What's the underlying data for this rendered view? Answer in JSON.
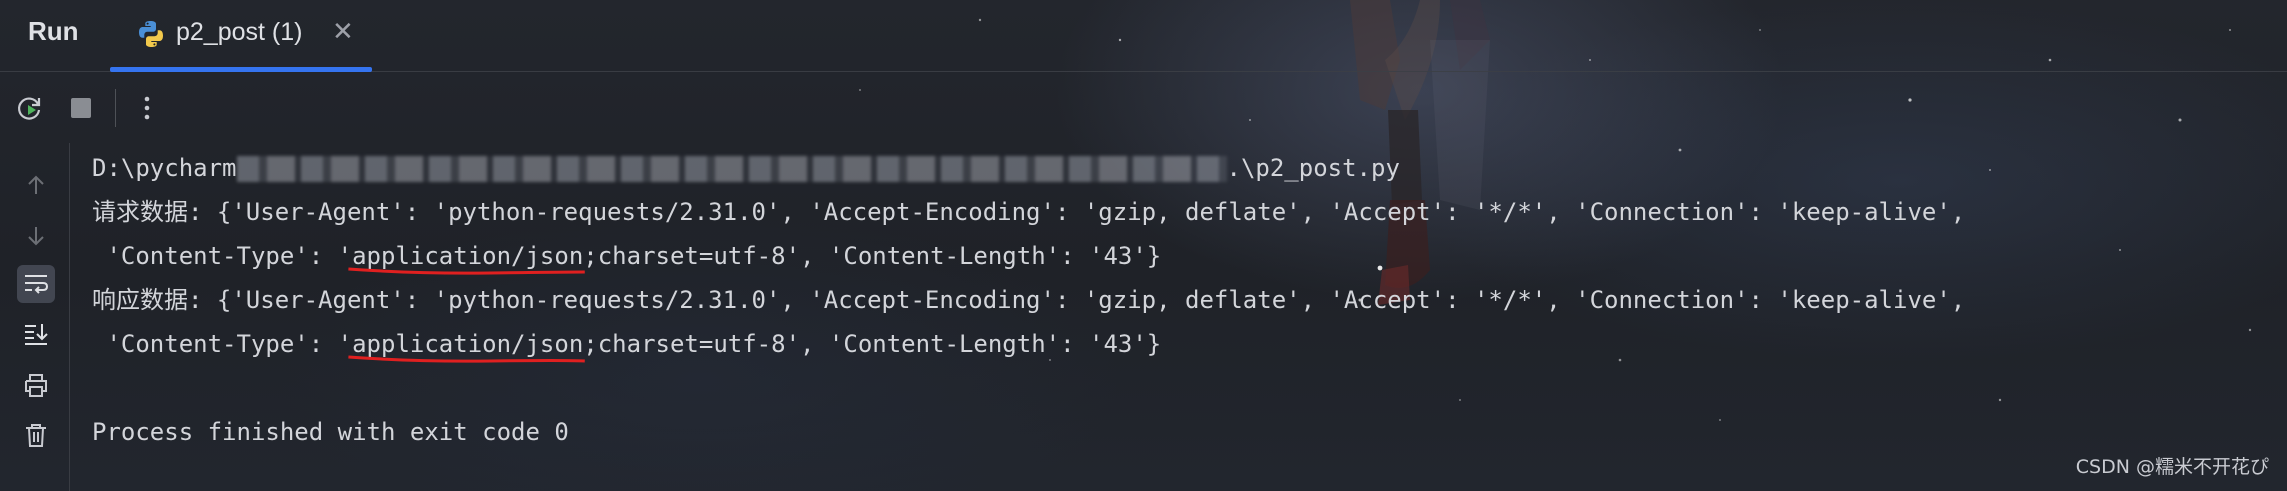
{
  "panel": {
    "title": "Run"
  },
  "tabs": [
    {
      "label": "p2_post (1)",
      "icon": "python-icon",
      "active": true
    }
  ],
  "toolbar": {
    "items": [
      {
        "name": "rerun-icon"
      },
      {
        "name": "stop-icon"
      },
      {
        "name": "more-icon"
      }
    ]
  },
  "gutter": {
    "items": [
      {
        "name": "up-arrow-icon"
      },
      {
        "name": "down-arrow-icon"
      },
      {
        "name": "soft-wrap-icon",
        "active": true
      },
      {
        "name": "scroll-to-end-icon"
      },
      {
        "name": "print-icon"
      },
      {
        "name": "trash-icon"
      }
    ]
  },
  "console": {
    "path_prefix": "D:\\pycharm",
    "path_suffix": ".\\p2_post.py",
    "request_prefix": "请求数据: {'User-Agent': 'python-requests/2.31.0', 'Accept-Encoding': 'gzip, deflate', 'Accept': '*/*', 'Connection': 'keep-alive',",
    "request_cont_pre": " 'Content-Type': '",
    "request_highlight": "application/json",
    "request_cont_post": ";charset=utf-8', 'Content-Length': '43'}",
    "response_prefix": "响应数据: {'User-Agent': 'python-requests/2.31.0', 'Accept-Encoding': 'gzip, deflate', 'Accept': '*/*', 'Connection': 'keep-alive',",
    "response_cont_pre": " 'Content-Type': '",
    "response_highlight": "application/json",
    "response_cont_post": ";charset=utf-8', 'Content-Length': '43'}",
    "exit_line": "Process finished with exit code 0"
  },
  "watermark": "CSDN @糯米不开花ぴ",
  "colors": {
    "accent": "#3574f0",
    "annotation": "#e02020",
    "console_text": "#d3d5da"
  }
}
